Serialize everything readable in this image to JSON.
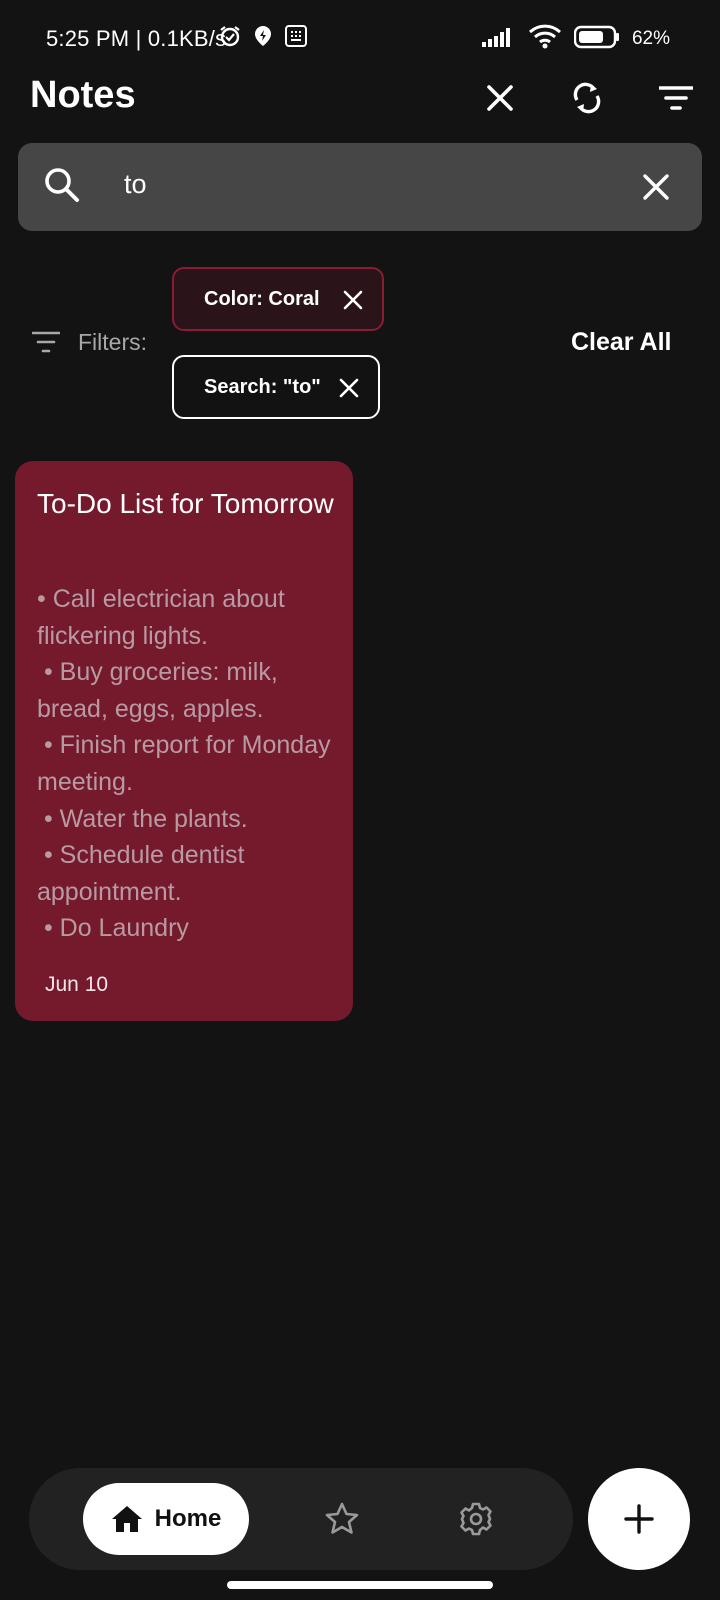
{
  "status_bar": {
    "time": "5:25 PM | 0.1KB/s",
    "battery": "62%"
  },
  "app_bar": {
    "title": "Notes"
  },
  "search": {
    "value": "to"
  },
  "filters": {
    "label": "Filters:",
    "chips": [
      {
        "label": "Color: Coral"
      },
      {
        "label": "Search: \"to\""
      }
    ],
    "clear_all": "Clear All"
  },
  "notes": [
    {
      "title": "To-Do List for Tomorrow",
      "body": "• Call electrician about flickering lights.\n • Buy groceries: milk, bread, eggs, apples.\n • Finish report for Monday meeting.\n • Water the plants.\n • Schedule dentist appointment.\n • Do Laundry",
      "date": "Jun 10",
      "color": "#751a2d"
    }
  ],
  "bottom_nav": {
    "home_label": "Home",
    "items": [
      "home-icon",
      "star-icon",
      "gear-icon"
    ]
  },
  "colors": {
    "background": "#131313",
    "search_bg": "#464646",
    "coral_note": "#751a2d",
    "chip_border_coral": "#8a1c33"
  }
}
